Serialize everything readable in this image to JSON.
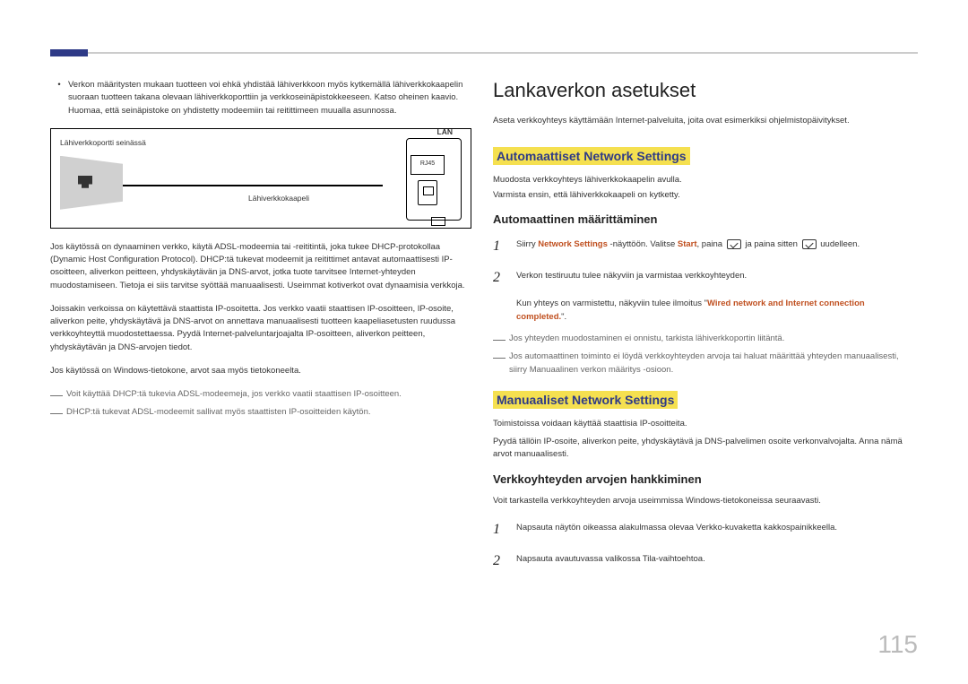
{
  "left": {
    "bullet": "Verkon määritysten mukaan tuotteen voi ehkä yhdistää lähiverkkoon myös kytkemällä lähiverkkokaapelin suoraan tuotteen takana olevaan lähiverkkoporttiin ja verkkoseinäpistokkeeseen. Katso oheinen kaavio. Huomaa, että seinäpistoke on yhdistetty modeemiin tai reitittimeen muualla asunnossa.",
    "diag_wall": "Lähiverkkoportti seinässä",
    "diag_cable": "Lähiverkkokaapeli",
    "diag_lan": "LAN",
    "diag_rj": "RJ45",
    "p1": "Jos käytössä on dynaaminen verkko, käytä ADSL-modeemia tai -reititintä, joka tukee DHCP-protokollaa (Dynamic Host Configuration Protocol). DHCP:tä tukevat modeemit ja reitittimet antavat automaattisesti IP-osoitteen, aliverkon peitteen, yhdyskäytävän ja DNS-arvot, jotka tuote tarvitsee Internet-yhteyden muodostamiseen. Tietoja ei siis tarvitse syöttää manuaalisesti. Useimmat kotiverkot ovat dynaamisia verkkoja.",
    "p2": "Joissakin verkoissa on käytettävä staattista IP-osoitetta. Jos verkko vaatii staattisen IP-osoitteen, IP-osoite, aliverkon peite, yhdyskäytävä ja DNS-arvot on annettava manuaalisesti tuotteen kaapeliasetusten ruudussa verkkoyhteyttä muodostettaessa. Pyydä Internet-palveluntarjoajalta IP-osoitteen, aliverkon peitteen, yhdyskäytävän ja DNS-arvojen tiedot.",
    "p3": "Jos käytössä on Windows-tietokone, arvot saa myös tietokoneelta.",
    "n1": "Voit käyttää DHCP:tä tukevia ADSL-modeemeja, jos verkko vaatii staattisen IP-osoitteen.",
    "n2": "DHCP:tä tukevat ADSL-modeemit sallivat myös staattisten IP-osoitteiden käytön."
  },
  "right": {
    "h1": "Lankaverkon asetukset",
    "intro": "Aseta verkkoyhteys käyttämään Internet-palveluita, joita ovat esimerkiksi ohjelmistopäivitykset.",
    "auto_head": "Automaattiset Network Settings",
    "auto_p1": "Muodosta verkkoyhteys lähiverkkokaapelin avulla.",
    "auto_p2": "Varmista ensin, että lähiverkkokaapeli on kytketty.",
    "auto_sub": "Automaattinen määrittäminen",
    "step1_a": "Siirry ",
    "step1_ns": "Network Settings",
    "step1_b": " -näyttöön. Valitse ",
    "step1_start": "Start",
    "step1_c": ", paina ",
    "step1_d": " ja paina sitten ",
    "step1_e": " uudelleen.",
    "step2": "Verkon testiruutu tulee näkyviin ja varmistaa verkkoyhteyden.",
    "step2b_a": "Kun yhteys on varmistettu, näkyviin tulee ilmoitus \"",
    "step2b_hl": "Wired network and Internet connection completed.",
    "step2b_b": "\".",
    "dn1": "Jos yhteyden muodostaminen ei onnistu, tarkista lähiverkkoportin liitäntä.",
    "dn2": "Jos automaattinen toiminto ei löydä verkkoyhteyden arvoja tai haluat määrittää yhteyden manuaalisesti, siirry Manuaalinen verkon määritys -osioon.",
    "man_head": "Manuaaliset Network Settings",
    "man_p1": "Toimistoissa voidaan käyttää staattisia IP-osoitteita.",
    "man_p2": "Pyydä tällöin IP-osoite, aliverkon peite, yhdyskäytävä ja DNS-palvelimen osoite verkonvalvojalta. Anna nämä arvot manuaalisesti.",
    "man_sub": "Verkkoyhteyden arvojen hankkiminen",
    "man_intro": "Voit tarkastella verkkoyhteyden arvoja useimmissa Windows-tietokoneissa seuraavasti.",
    "mstep1": "Napsauta näytön oikeassa alakulmassa olevaa Verkko-kuvaketta kakkospainikkeella.",
    "mstep2": "Napsauta avautuvassa valikossa Tila-vaihtoehtoa."
  },
  "page": "115"
}
